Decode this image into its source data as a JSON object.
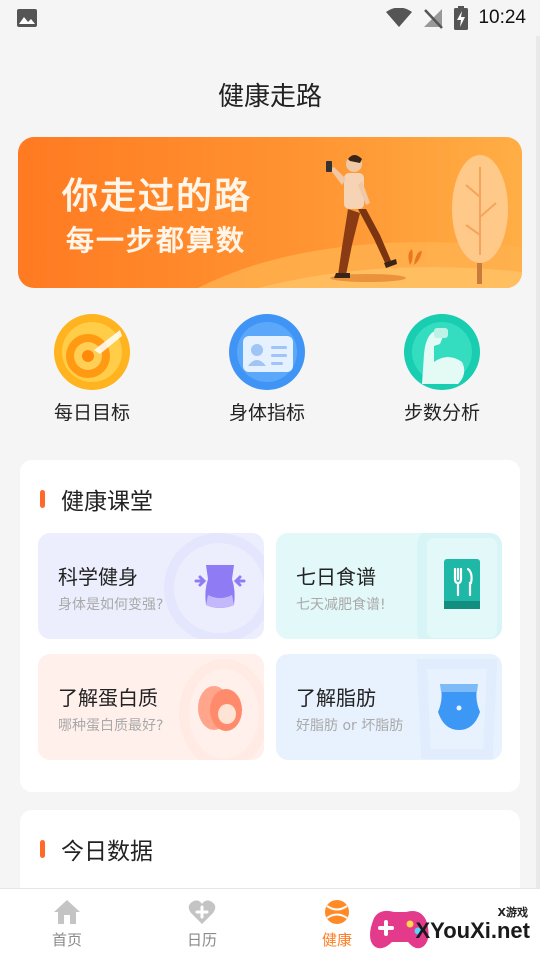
{
  "status_bar": {
    "time": "10:24"
  },
  "header": {
    "title": "健康走路"
  },
  "banner": {
    "line1": "你走过的路",
    "line2": "每一步都算数"
  },
  "quick_links": [
    {
      "label": "每日目标",
      "icon": "target-coin-icon"
    },
    {
      "label": "身体指标",
      "icon": "id-card-icon"
    },
    {
      "label": "步数分析",
      "icon": "arm-muscle-icon"
    }
  ],
  "health_class": {
    "title": "健康课堂",
    "tiles": [
      {
        "title": "科学健身",
        "subtitle": "身体是如何变强?",
        "icon": "waist-icon",
        "bg": "#eceefe"
      },
      {
        "title": "七日食谱",
        "subtitle": "七天减肥食谱!",
        "icon": "recipe-book-icon",
        "bg": "#e2f8f9"
      },
      {
        "title": "了解蛋白质",
        "subtitle": "哪种蛋白质最好?",
        "icon": "egg-icon",
        "bg": "#fff0ec"
      },
      {
        "title": "了解脂肪",
        "subtitle": "好脂肪 or 坏脂肪",
        "icon": "belly-icon",
        "bg": "#e8f2fe"
      }
    ]
  },
  "today_data": {
    "title": "今日数据"
  },
  "tab_bar": {
    "tabs": [
      {
        "label": "首页",
        "icon": "home-icon",
        "active": false
      },
      {
        "label": "日历",
        "icon": "heart-plus-icon",
        "active": false
      },
      {
        "label": "健康",
        "icon": "ball-icon",
        "active": true
      }
    ]
  },
  "watermark": {
    "small": "X游戏",
    "big": "XYouXi.net"
  },
  "colors": {
    "accent": "#ff7f26",
    "banner": "#ff8a2b",
    "bar": "#ff6a2a"
  }
}
